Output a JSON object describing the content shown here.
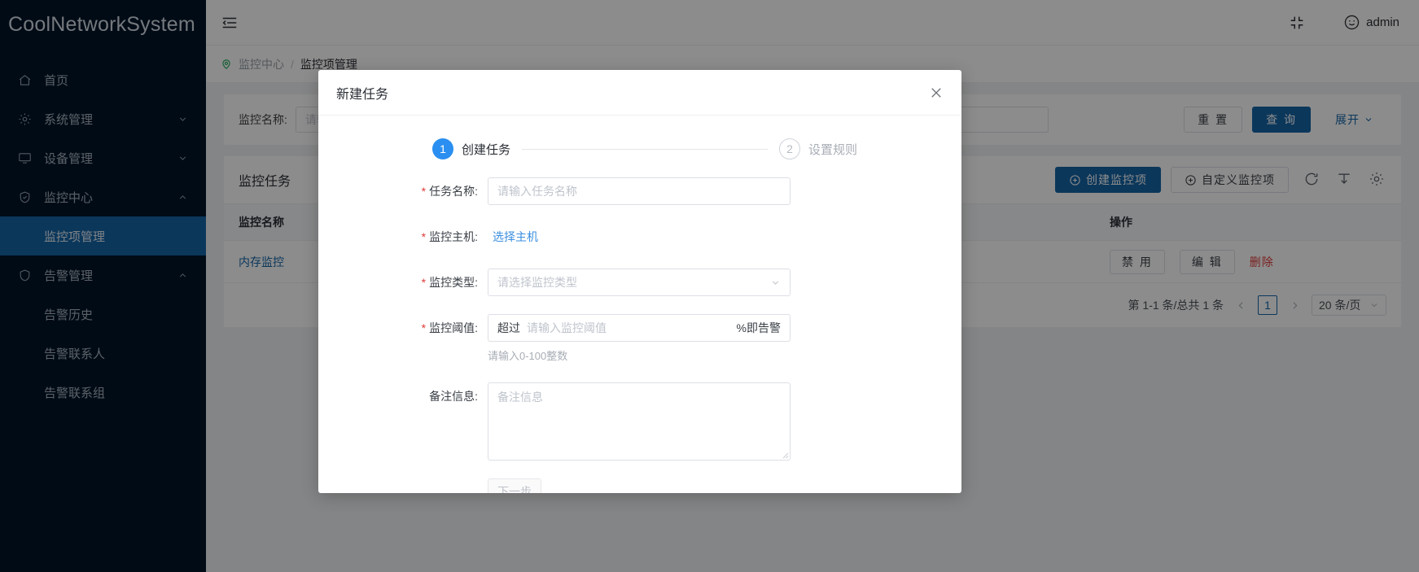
{
  "sidebar": {
    "brand": "CoolNetworkSystem",
    "items": [
      {
        "label": "首页",
        "icon": "home-icon",
        "arrow": ""
      },
      {
        "label": "系统管理",
        "icon": "gear-icon",
        "arrow": "chevron-down-icon"
      },
      {
        "label": "设备管理",
        "icon": "monitor-icon",
        "arrow": "chevron-down-icon"
      },
      {
        "label": "监控中心",
        "icon": "shield-icon",
        "arrow": "chevron-up-icon"
      }
    ],
    "monitor_children": [
      {
        "label": "监控项管理",
        "active": true
      }
    ],
    "alarm": {
      "label": "告警管理",
      "icon": "shield-icon",
      "arrow": "chevron-up-icon"
    },
    "alarm_children": [
      {
        "label": "告警历史"
      },
      {
        "label": "告警联系人"
      },
      {
        "label": "告警联系组"
      }
    ],
    "active_color": "#1565a7",
    "background": "#001428"
  },
  "topbar": {
    "collapse_icon": "menu-collapse-icon",
    "fullscreen_icon": "fullscreen-exit-icon",
    "avatar_icon": "smiley-avatar-icon",
    "user": "admin"
  },
  "breadcrumb": {
    "icon": "location-pin-icon",
    "parent": "监控中心",
    "separator": "/",
    "current": "监控项管理"
  },
  "search": {
    "label": "监控名称:",
    "placeholder": "请输入监控名称",
    "value": "",
    "reset_label": "重 置",
    "query_label": "查 询",
    "expand_label": "展开",
    "expand_icon": "chevron-down-icon"
  },
  "table": {
    "title": "监控任务",
    "create_label": "创建监控项",
    "custom_label": "自定义监控项",
    "plus_icon": "plus-circle-icon",
    "refresh_icon": "refresh-icon",
    "density_icon": "density-icon",
    "settings_icon": "gear-icon",
    "columns": [
      "监控名称",
      "操作"
    ],
    "rows": [
      {
        "name": "内存监控",
        "actions": [
          "禁 用",
          "编 辑",
          "删除"
        ]
      }
    ],
    "action_delete_color": "#e03b3b"
  },
  "pagination": {
    "summary": "第 1-1 条/总共 1 条",
    "prev_icon": "chevron-left-icon",
    "next_icon": "chevron-right-icon",
    "current_page": "1",
    "page_size": "20 条/页",
    "page_size_icon": "chevron-down-icon"
  },
  "modal": {
    "title": "新建任务",
    "close_icon": "close-icon",
    "steps": [
      {
        "num": "1",
        "label": "创建任务",
        "state": "active"
      },
      {
        "num": "2",
        "label": "设置规则",
        "state": "inactive"
      }
    ],
    "fields": {
      "task_name": {
        "required": true,
        "label": "任务名称:",
        "placeholder": "请输入任务名称",
        "value": ""
      },
      "monitor_host": {
        "required": true,
        "label": "监控主机:",
        "link_label": "选择主机"
      },
      "monitor_type": {
        "required": true,
        "label": "监控类型:",
        "placeholder": "请选择监控类型",
        "value": "",
        "caret_icon": "chevron-down-icon"
      },
      "threshold": {
        "required": true,
        "label": "监控阈值:",
        "prefix": "超过",
        "placeholder": "请输入监控阈值",
        "value": "",
        "suffix": "%即告警",
        "hint": "请输入0-100整数"
      },
      "remark": {
        "required": false,
        "label": "备注信息:",
        "placeholder": "备注信息",
        "value": ""
      }
    },
    "next_label": "下一步"
  }
}
